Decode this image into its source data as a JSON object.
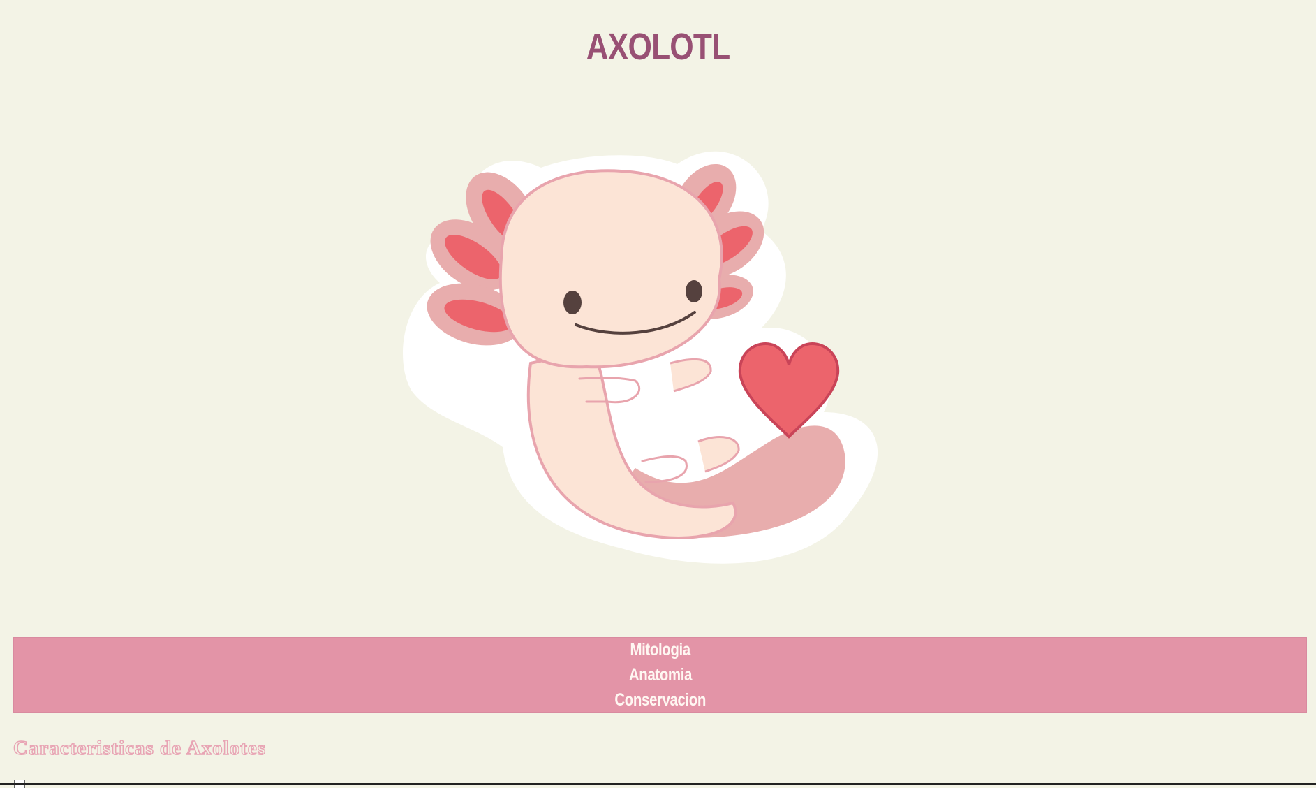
{
  "header": {
    "title": "AXOLOTL"
  },
  "hero": {
    "image_icon": "axolotl-illustration"
  },
  "nav": {
    "items": [
      {
        "label": "Mitologia"
      },
      {
        "label": "Anatomia"
      },
      {
        "label": "Conservacion"
      }
    ],
    "background_color": "#e394a7"
  },
  "section": {
    "title": "Caracteristicas de Axolotes"
  },
  "colors": {
    "background": "#f3f3e6",
    "title": "#985074",
    "accent_pink": "#e394a7",
    "heart_red": "#ec646c"
  }
}
